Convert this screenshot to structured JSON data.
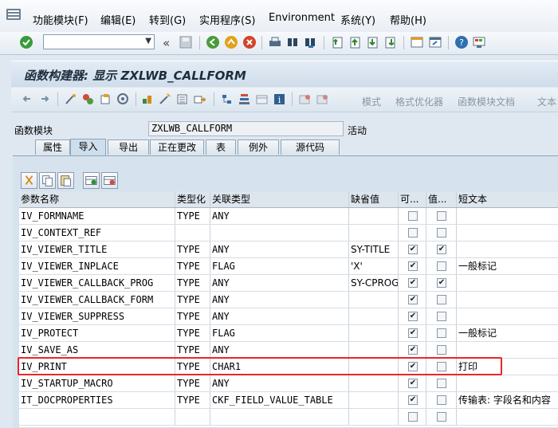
{
  "menu": [
    "功能模块(F)",
    "编辑(E)",
    "转到(G)",
    "实用程序(S)",
    "Environment",
    "系统(Y)",
    "帮助(H)"
  ],
  "toolbar": {
    "command_value": "",
    "nav_back": "«"
  },
  "title": "函数构建器: 显示 ZXLWB_CALLFORM",
  "app_toolbar": {
    "pattern_label": "模式",
    "pretty_printer_label": "格式优化器",
    "fm_doc_label": "函数模块文档",
    "text_label": "文本"
  },
  "function_module": {
    "label": "函数模块",
    "value": "ZXLWB_CALLFORM",
    "status": "活动"
  },
  "tabs": [
    "属性",
    "导入",
    "导出",
    "正在更改",
    "表",
    "例外",
    "源代码"
  ],
  "active_tab": "导入",
  "grid": {
    "columns": [
      "参数名称",
      "类型化",
      "关联类型",
      "缺省值",
      "可...",
      "值...",
      "短文本"
    ],
    "rows": [
      {
        "name": "IV_FORMNAME",
        "typing": "TYPE",
        "ref_type": "ANY",
        "default": "",
        "optional": false,
        "pass_value": false,
        "short_text": ""
      },
      {
        "name": "IV_CONTEXT_REF",
        "typing": "",
        "ref_type": "",
        "default": "",
        "optional": false,
        "pass_value": false,
        "short_text": ""
      },
      {
        "name": "IV_VIEWER_TITLE",
        "typing": "TYPE",
        "ref_type": "ANY",
        "default": "SY-TITLE",
        "optional": true,
        "pass_value": true,
        "short_text": ""
      },
      {
        "name": "IV_VIEWER_INPLACE",
        "typing": "TYPE",
        "ref_type": "FLAG",
        "default": "'X'",
        "optional": true,
        "pass_value": false,
        "short_text": "一般标记"
      },
      {
        "name": "IV_VIEWER_CALLBACK_PROG",
        "typing": "TYPE",
        "ref_type": "ANY",
        "default": "SY-CPROG",
        "optional": true,
        "pass_value": true,
        "short_text": ""
      },
      {
        "name": "IV_VIEWER_CALLBACK_FORM",
        "typing": "TYPE",
        "ref_type": "ANY",
        "default": "",
        "optional": true,
        "pass_value": false,
        "short_text": ""
      },
      {
        "name": "IV_VIEWER_SUPPRESS",
        "typing": "TYPE",
        "ref_type": "ANY",
        "default": "",
        "optional": true,
        "pass_value": false,
        "short_text": ""
      },
      {
        "name": "IV_PROTECT",
        "typing": "TYPE",
        "ref_type": "FLAG",
        "default": "",
        "optional": true,
        "pass_value": false,
        "short_text": "一般标记"
      },
      {
        "name": "IV_SAVE_AS",
        "typing": "TYPE",
        "ref_type": "ANY",
        "default": "",
        "optional": true,
        "pass_value": false,
        "short_text": ""
      },
      {
        "name": "IV_PRINT",
        "typing": "TYPE",
        "ref_type": "CHAR1",
        "default": "",
        "optional": true,
        "pass_value": false,
        "short_text": "打印"
      },
      {
        "name": "IV_STARTUP_MACRO",
        "typing": "TYPE",
        "ref_type": "ANY",
        "default": "",
        "optional": true,
        "pass_value": false,
        "short_text": ""
      },
      {
        "name": "IT_DOCPROPERTIES",
        "typing": "TYPE",
        "ref_type": "CKF_FIELD_VALUE_TABLE",
        "default": "",
        "optional": true,
        "pass_value": false,
        "short_text": "传输表: 字段名和内容"
      },
      {
        "name": "",
        "typing": "",
        "ref_type": "",
        "default": "",
        "optional": false,
        "pass_value": false,
        "short_text": ""
      }
    ]
  },
  "colors": {
    "highlight_border": "#e8262a",
    "menu_bg": "#f2f5f9",
    "panel_bg": "#d6e2ee"
  }
}
